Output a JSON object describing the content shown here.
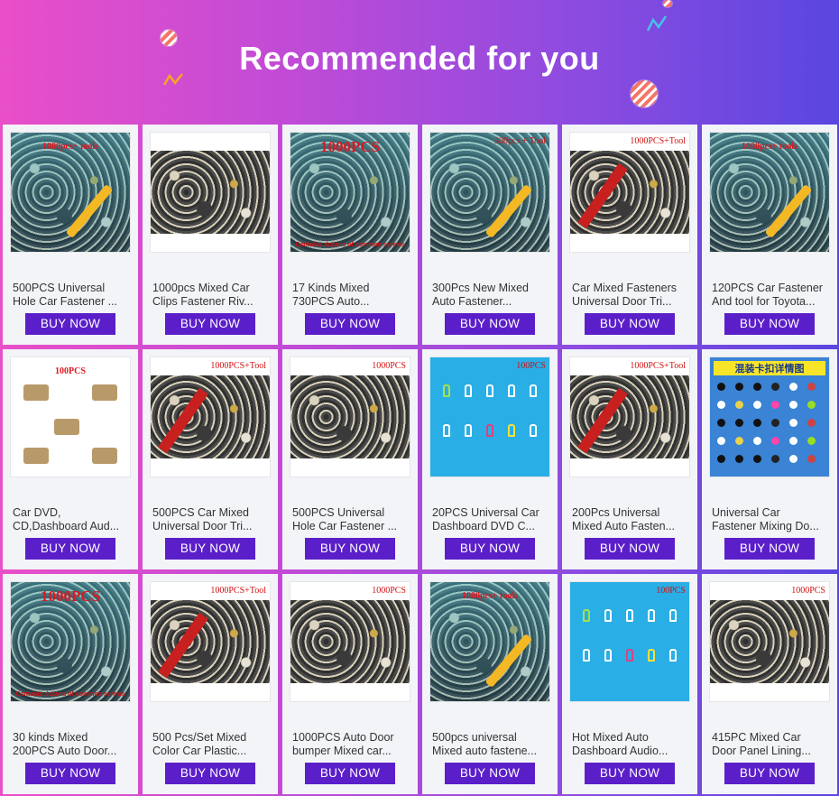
{
  "header": {
    "title": "Recommended for you"
  },
  "buy_label": "BUY NOW",
  "products": [
    {
      "line1": "500PCS Universal",
      "line2": "Hole Car Fastener ...",
      "thumb": "blue-tools",
      "badge": "1000pcs+ tools"
    },
    {
      "line1": "1000pcs Mixed Car",
      "line2": "Clips Fastener Riv...",
      "thumb": "bag",
      "badge": ""
    },
    {
      "line1": "17 Kinds Mixed",
      "line2": "730PCS Auto...",
      "thumb": "big-red",
      "badge": "1000PCS",
      "foot": "Contains dozens of common screws"
    },
    {
      "line1": "300Pcs New Mixed",
      "line2": "Auto Fastener...",
      "thumb": "blue-tool",
      "badge": "300pcs + Tool"
    },
    {
      "line1": "Car Mixed Fasteners",
      "line2": "Universal Door Tri...",
      "thumb": "redtool",
      "badge": "1000PCS+Tool"
    },
    {
      "line1": "120PCS Car Fastener",
      "line2": "And tool for Toyota...",
      "thumb": "blue-tools",
      "badge": "1000pcs+ tools"
    },
    {
      "line1": "Car DVD,",
      "line2": "CD,Dashboard Aud...",
      "thumb": "diagram",
      "badge": "100PCS"
    },
    {
      "line1": "500PCS Car Mixed",
      "line2": "Universal Door Tri...",
      "thumb": "redtool",
      "badge": "1000PCS+Tool"
    },
    {
      "line1": "500PCS Universal",
      "line2": "Hole Car Fastener ...",
      "thumb": "bag-label",
      "badge": "1000PCS"
    },
    {
      "line1": "20PCS Universal Car",
      "line2": "Dashboard DVD C...",
      "thumb": "clips",
      "badge": "100PCS"
    },
    {
      "line1": "200Pcs Universal",
      "line2": "Mixed Auto Fasten...",
      "thumb": "redtool",
      "badge": "1000PCS+Tool"
    },
    {
      "line1": "Universal Car",
      "line2": "Fastener Mixing Do...",
      "thumb": "mixed",
      "badge": "混装卡扣详情图"
    },
    {
      "line1": "30 kinds Mixed",
      "line2": "200PCS Auto Door...",
      "thumb": "big-red",
      "badge": "1000PCS",
      "foot": "Contains dozens of common screws"
    },
    {
      "line1": "500 Pcs/Set Mixed",
      "line2": "Color Car Plastic...",
      "thumb": "redtool",
      "badge": "1000PCS+Tool"
    },
    {
      "line1": "1000PCS Auto Door",
      "line2": "bumper Mixed car...",
      "thumb": "bag-label",
      "badge": "1000PCS"
    },
    {
      "line1": "500pcs universal",
      "line2": "Mixed auto fastene...",
      "thumb": "blue-tools",
      "badge": "1000pcs+ tools"
    },
    {
      "line1": "Hot Mixed Auto",
      "line2": "Dashboard Audio...",
      "thumb": "clips",
      "badge": "100PCS"
    },
    {
      "line1": "415PC Mixed Car",
      "line2": "Door Panel Lining...",
      "thumb": "bag-label",
      "badge": "1000PCS"
    }
  ],
  "colors": {
    "buy_button": "#5b1fc9",
    "card_bg": "#f3f4f8",
    "badge_red": "#e0161f"
  }
}
